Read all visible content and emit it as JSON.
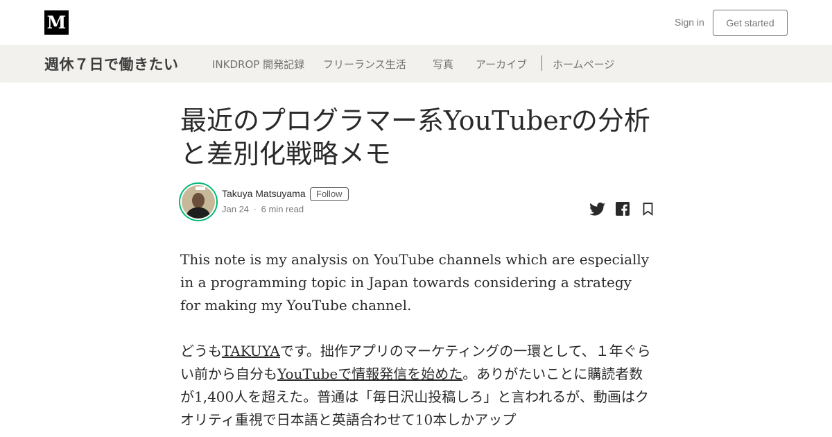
{
  "header": {
    "logo_letter": "M",
    "sign_in": "Sign in",
    "get_started": "Get started"
  },
  "publication": {
    "name": "週休７日で働きたい",
    "nav": [
      "INKDROP 開発記録",
      "フリーランス生活",
      "写真",
      "アーカイブ",
      "ホームページ"
    ]
  },
  "article": {
    "title": "最近のプログラマー系YouTuberの分析と差別化戦略メモ",
    "author": "Takuya Matsuyama",
    "follow_label": "Follow",
    "date": "Jan 24",
    "read_time": "6 min read",
    "meta_separator": "·",
    "intro": "This note is my analysis on YouTube channels which are especially in a programming topic in Japan towards considering a strategy for making my YouTube channel.",
    "p2": {
      "t1": "どうも",
      "link1": "TAKUYA",
      "t2": "です。拙作アプリのマーケティングの一環として、１年ぐらい前から自分も",
      "link2": "YouTubeで情報発信を始めた",
      "t3": "。ありがたいことに購読者数が1,400人を超えた。普通は「毎日沢山投稿しろ」と言われるが、動画はクオリティ重視で日本語と英語合わせて10本しかアップ"
    }
  },
  "icons": {
    "twitter": "twitter-icon",
    "facebook": "facebook-icon",
    "bookmark": "bookmark-icon"
  }
}
